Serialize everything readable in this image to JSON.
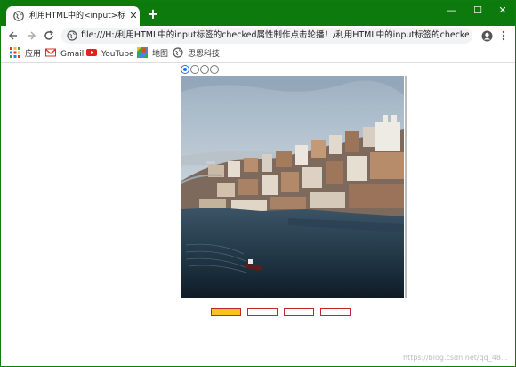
{
  "browser": {
    "tab_title": "利用HTML中的<input>标签的c",
    "tab_close": "✕",
    "new_tab": "+",
    "window_controls": {
      "minimize": "—",
      "maximize": "☐",
      "close": "✕"
    },
    "url": "file:///H:/利用HTML中的input标签的checked属性制作点击轮播！/利用HTML中的input标签的checked属性...",
    "theme_color": "#0d7a0d"
  },
  "bookmarks": [
    {
      "label": "应用",
      "icon": "apps-grid-icon"
    },
    {
      "label": "Gmail",
      "icon": "gmail-icon"
    },
    {
      "label": "YouTube",
      "icon": "youtube-icon"
    },
    {
      "label": "地图",
      "icon": "maps-icon"
    },
    {
      "label": "思恩科技",
      "icon": "globe-icon"
    }
  ],
  "carousel": {
    "radio_count": 4,
    "checked_index": 0,
    "active_dot_index": 0,
    "dot_count": 4,
    "dot_active_color": "#f6c41a",
    "dot_border_color": "#c0282f",
    "image_subject": "riverside city (Porto) photo"
  },
  "watermark": "https://blog.csdn.net/qq_48..."
}
